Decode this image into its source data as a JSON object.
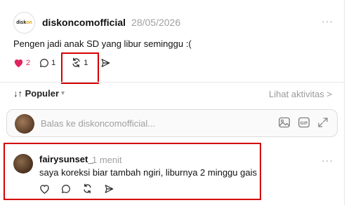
{
  "post": {
    "logo_text_a": "disk",
    "logo_text_b": "on",
    "username": "diskoncomofficial",
    "date": "28/05/2026",
    "more": "···",
    "text": "Pengen jadi anak SD yang libur seminggu :(",
    "likes": "2",
    "replies": "1",
    "reposts": "1"
  },
  "sort": {
    "label": "↓↑ Populer",
    "activity": "Lihat aktivitas >"
  },
  "reply": {
    "placeholder": "Balas ke diskoncomofficial..."
  },
  "comment": {
    "username": "fairysunset_",
    "time": "1 menit",
    "more": "···",
    "text": "saya koreksi biar tambah ngiri, liburnya 2 minggu gais"
  },
  "colors": {
    "accent_red": "#e0245e",
    "highlight": "#d40000"
  }
}
